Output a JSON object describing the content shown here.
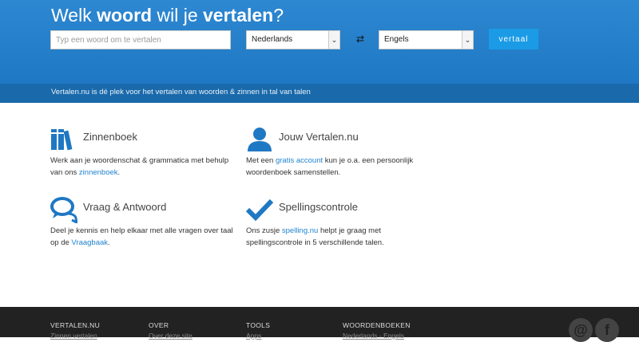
{
  "header": {
    "title_part1": "Welk ",
    "title_bold1": "woord",
    "title_part2": " wil je ",
    "title_bold2": "vertalen",
    "title_part3": "?",
    "search_placeholder": "Typ een woord om te vertalen",
    "from_language": "Nederlands",
    "to_language": "Engels",
    "swap_icon": "swap-arrows-icon",
    "translate_label": "vertaal",
    "tagline": "Vertalen.nu is dé plek voor het vertalen van woorden & zinnen in tal van talen"
  },
  "features": [
    {
      "title": "Zinnenboek",
      "icon": "books-icon",
      "text_before": "Werk aan je woordenschat & grammatica met behulp van ons ",
      "link": "zinnenboek",
      "text_after": "."
    },
    {
      "title": "Jouw Vertalen.nu",
      "icon": "user-icon",
      "text_before": "Met een ",
      "link": "gratis account",
      "text_after": " kun je o.a. een persoonlijk woordenboek samenstellen."
    },
    {
      "title": "Vraag & Antwoord",
      "icon": "speech-bubbles-icon",
      "text_before": "Deel je kennis en help elkaar met alle vragen over taal op de ",
      "link": "Vraagbaak",
      "text_after": "."
    },
    {
      "title": "Spellingscontrole",
      "icon": "checkmark-icon",
      "text_before": "Ons zusje ",
      "link": "spelling.nu",
      "text_after": " helpt je graag met spellingscontrole in 5 verschillende talen."
    }
  ],
  "footer": {
    "columns": [
      {
        "heading": "VERTALEN.NU",
        "link": "Zinnen vertalen"
      },
      {
        "heading": "OVER",
        "link": "Over deze site"
      },
      {
        "heading": "TOOLS",
        "link": "Apps"
      },
      {
        "heading": "WOORDENBOEKEN",
        "link": "Nederlands - Engels"
      }
    ],
    "social": [
      {
        "icon": "email-icon",
        "glyph": "@"
      },
      {
        "icon": "facebook-icon",
        "glyph": "f"
      }
    ]
  },
  "colors": {
    "hero_blue": "#2381cc",
    "tagbar_blue": "#1a6aab",
    "button_blue": "#1b9be6",
    "icon_blue": "#1f78c3",
    "footer_dark": "#222222"
  }
}
